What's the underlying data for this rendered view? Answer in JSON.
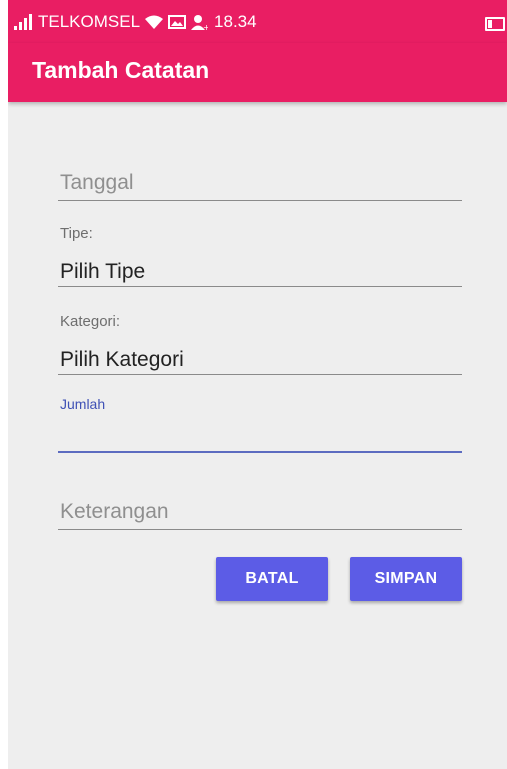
{
  "status_bar": {
    "carrier": "TELKOMSEL",
    "time": "18.34",
    "icons": [
      "signal-icon",
      "wifi-icon",
      "image-icon",
      "person-icon",
      "battery-icon"
    ]
  },
  "app_bar": {
    "title": "Tambah Catatan",
    "color": "#e91e63"
  },
  "form": {
    "tanggal": {
      "placeholder": "Tanggal"
    },
    "tipe": {
      "label": "Tipe:",
      "value": "Pilih Tipe"
    },
    "kategori": {
      "label": "Kategori:",
      "value": "Pilih Kategori"
    },
    "jumlah": {
      "label": "Jumlah",
      "value": ""
    },
    "keterangan": {
      "placeholder": "Keterangan"
    }
  },
  "buttons": {
    "batal": "BATAL",
    "simpan": "SIMPAN",
    "color": "#5c5ce6"
  }
}
